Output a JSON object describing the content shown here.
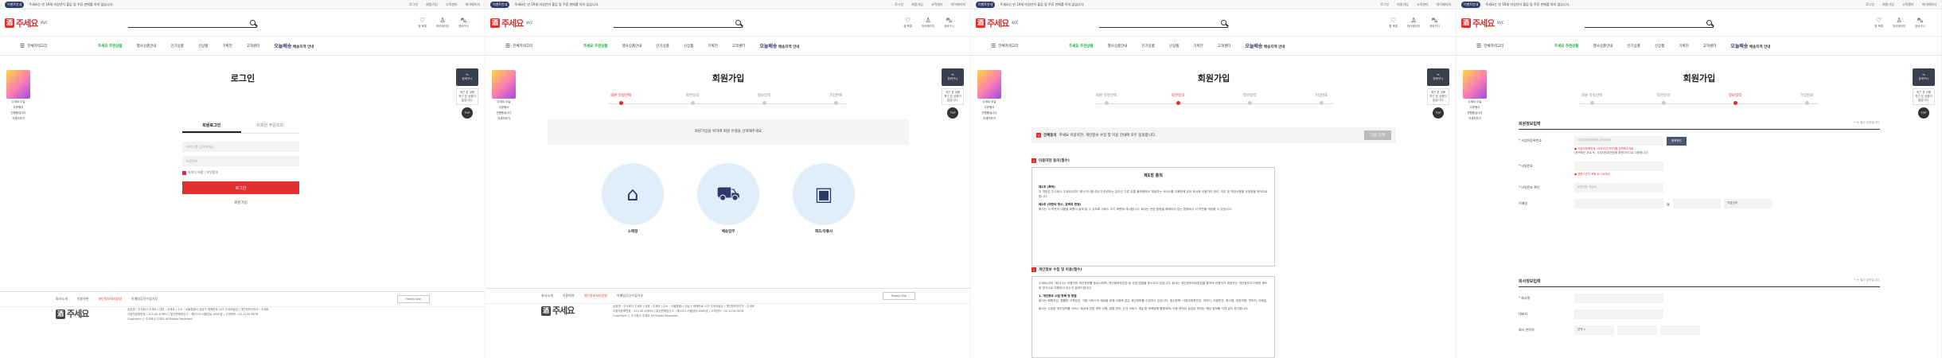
{
  "brand": {
    "name": "주세요",
    "mark": "酒",
    "sub": "KVC"
  },
  "topbar": {
    "badge": "이벤트안내",
    "message": "주세요는 만 19세 미성년자 출입 및 주류 판매를 하지 않습니다.",
    "links": [
      "로그인",
      "회원가입",
      "고객센터",
      "마이페이지"
    ]
  },
  "header_icons": [
    {
      "icon": "heart-icon",
      "glyph": "♡",
      "label": "찜 목록"
    },
    {
      "icon": "user-icon",
      "glyph": "♙",
      "label": "마이페이지"
    },
    {
      "icon": "cart-icon",
      "glyph": "⛍",
      "label": "장바구니"
    }
  ],
  "nav": {
    "category": "전체카테고리",
    "brand_link": "주세요 추천상품",
    "items": [
      "행사상품안내",
      "인기상품",
      "신상품",
      "기획전",
      "고객센터"
    ],
    "delivery": "오늘배송",
    "delivery_sub": "배송지역 안내"
  },
  "sidebanner": {
    "lines": [
      "주세요 오늘",
      "주류행사",
      "진행중입니다",
      "자세히보기"
    ]
  },
  "rside": {
    "cart": "장바구니",
    "cart_count": "0",
    "recent": "최근 본 상품",
    "recent_sub": "최근 본 상품이 없습니다.",
    "top": "TOP"
  },
  "login": {
    "title": "로그인",
    "tabs": [
      "회원로그인",
      "비회원 주문조회"
    ],
    "id_placeholder": "아이디를 입력하세요",
    "pw_placeholder": "비밀번호",
    "save_id": "아이디 저장 / 보안접속",
    "login_btn": "로그인",
    "join_link": "회원가입"
  },
  "join": {
    "title": "회원가입",
    "steps": [
      "회원 유형선택",
      "약관동의",
      "정보입력",
      "가입완료"
    ],
    "guide": "회원가입을 위하여 회원 유형을 선택해주세요",
    "types": [
      {
        "icon": "store-icon",
        "glyph": "⌂",
        "label": "소매점"
      },
      {
        "icon": "truck-icon",
        "glyph": "⛟",
        "label": "배송업무"
      },
      {
        "icon": "box-hand-icon",
        "glyph": "▣",
        "label": "제조/유통사"
      }
    ]
  },
  "terms": {
    "all_label": "전체동의",
    "all_desc": "주세요 이용약관, 개인정보 수집 및 이용 안내에 모두 동의합니다.",
    "next_btn": "다음 단계",
    "t1_head": "이용약관 동의(필수)",
    "t1_title": "제1장 총칙",
    "t1_paras": [
      {
        "h": "제1조 (목적)",
        "t": "이 약관은 주식회사 주세요(이하 \"회사\"라 합니다)가 운영하는 온라인 주류 유통 플랫폼에서 제공하는 서비스를 이용함에 있어 회사와 이용자의 권리, 의무 및 책임사항을 규정함을 목적으로 합니다."
      },
      {
        "h": "제2조 (약관의 명시, 효력과 변경)",
        "t": "회사는 이 약관의 내용을 회원이 쉽게 알 수 있도록 서비스 초기 화면에 게시합니다. 회사는 관련 법령을 위배하지 않는 범위에서 이 약관을 개정할 수 있습니다."
      }
    ],
    "t2_head": "개인정보 수집 및 이용(필수)",
    "t2_paras": [
      {
        "h": "",
        "t": "주세요(이하 \"회사\")는 이용자의 개인정보를 중요시하며, 개인정보보호법 등 관련 법령을 준수하고 있습니다. 회사는 개인정보처리방침을 통하여 이용자가 제공하는 개인정보가 어떠한 용도와 방식으로 이용되고 있는지 알려드립니다."
      },
      {
        "h": "1. 개인정보 수집 항목 및 방법",
        "t": "회사는 회원가입, 원활한 고객상담, 각종 서비스의 제공을 위해 아래와 같은 개인정보를 수집하고 있습니다. 필수항목: 사업자등록번호, 아이디, 비밀번호, 회사명, 대표자명, 연락처, 이메일"
      },
      {
        "h": "",
        "t": "회사는 수집한 개인정보를 서비스 제공에 관한 계약 이행, 회원 관리, 신규 서비스 개발 및 마케팅에 활용하며, 이용 목적이 달성된 후에는 해당 정보를 지체 없이 파기합니다."
      }
    ]
  },
  "form": {
    "sec1": "회원정보입력",
    "req": "* 는 필수 입력입니다.",
    "rows": [
      {
        "label": "* 사업자등록번호",
        "ph": "사업자등록번호를 입력하세요",
        "btn": "중복확인"
      },
      {
        "label": "* 비밀번호",
        "ph": "",
        "btn": ""
      },
      {
        "label": "* 비밀번호 확인",
        "ph": "비밀번호 재입력",
        "btn": ""
      },
      {
        "label": "이메일",
        "ph": "",
        "btn": ""
      }
    ],
    "note1": "● 사업자등록번호 10자리(숫자만)를 입력해주세요",
    "note1b": "(중복확인 완료 후, 사업자등록번호를 회원아이디로 사용합니다)",
    "note2": "● 영문+숫자 포함 8~16자리",
    "email_domain": "직접입력",
    "sec2": "회사정보입력",
    "rows2": [
      {
        "label": "* 회사명"
      },
      {
        "label": "대표자"
      },
      {
        "label": "회사 연락처",
        "sel": "선택 ∨"
      }
    ]
  },
  "footer": {
    "links": [
      "회사소개",
      "이용약관",
      "개인정보처리방침",
      "이메일무단수집거부"
    ],
    "family": "Family Site",
    "info1": "상호명 : 주식회사 주세요 | 대표 : 주세요 | 주소 : 서울특별시 강남구 테헤란로 123 주세요빌딩 | 개인정보관리자 : 주세요",
    "info2": "사업자등록번호 : 123-45-67890 | 통신판매업신고 : 제2023-서울강남-0000호 | 고객센터 : 02-1234-5678",
    "copy": "Copyright ⓒ 주식회사 주세요 All Rights Reserved."
  }
}
